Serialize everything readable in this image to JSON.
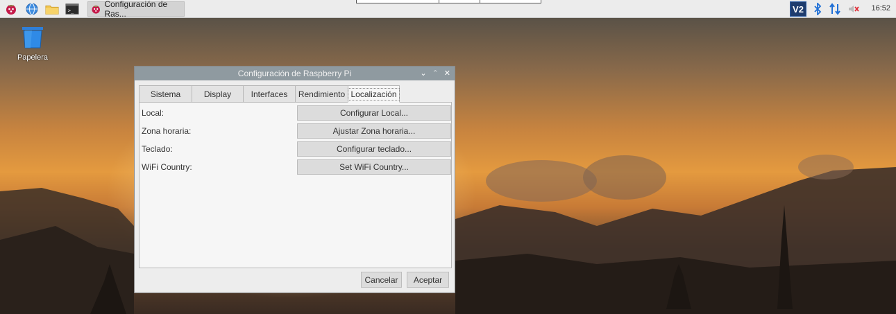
{
  "taskbar": {
    "menu_icon": "raspberry-icon",
    "browser_icon": "globe-icon",
    "files_icon": "folder-icon",
    "terminal_icon": "terminal-icon",
    "task_label": "Configuración de Ras...",
    "vnc_label": "V2",
    "clock": "16:52"
  },
  "desktop": {
    "trash_label": "Papelera"
  },
  "window": {
    "title": "Configuración de Raspberry Pi",
    "tabs": [
      {
        "label": "Sistema"
      },
      {
        "label": "Display"
      },
      {
        "label": "Interfaces"
      },
      {
        "label": "Rendimiento"
      },
      {
        "label": "Localización"
      }
    ],
    "active_tab": "Localización",
    "rows": [
      {
        "label": "Local:",
        "button": "Configurar Local..."
      },
      {
        "label": "Zona horaria:",
        "button": "Ajustar Zona horaria..."
      },
      {
        "label": "Teclado:",
        "button": "Configurar teclado..."
      },
      {
        "label": "WiFi Country:",
        "button": "Set WiFi Country..."
      }
    ],
    "cancel_label": "Cancelar",
    "ok_label": "Aceptar"
  },
  "colors": {
    "titlebar": "#8f9aa0",
    "taskbar": "#ececec",
    "accent_blue": "#1f6fd6"
  }
}
